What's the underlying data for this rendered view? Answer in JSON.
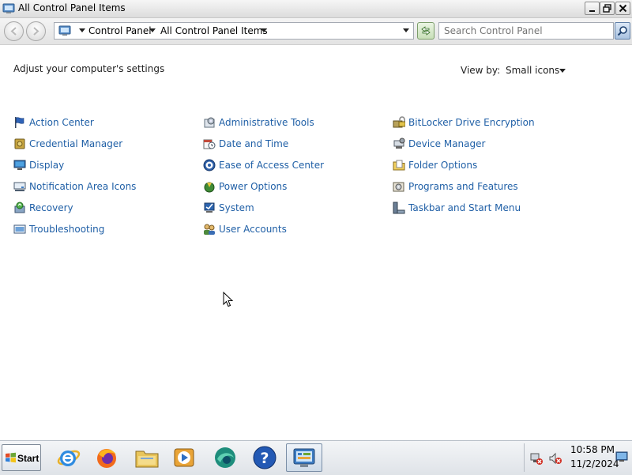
{
  "window": {
    "title": "All Control Panel Items"
  },
  "address_bar": {
    "breadcrumb": [
      "Control Panel",
      "All Control Panel Items"
    ],
    "search_placeholder": "Search Control Panel"
  },
  "content": {
    "heading": "Adjust your computer's settings",
    "view_by_label": "View by:",
    "view_by_value": "Small icons",
    "items": [
      {
        "label": "Action Center",
        "icon": "flag-icon"
      },
      {
        "label": "Credential Manager",
        "icon": "vault-icon"
      },
      {
        "label": "Display",
        "icon": "monitor-icon"
      },
      {
        "label": "Notification Area Icons",
        "icon": "notification-area-icon"
      },
      {
        "label": "Recovery",
        "icon": "recovery-icon"
      },
      {
        "label": "Troubleshooting",
        "icon": "troubleshooting-icon"
      },
      {
        "label": "Administrative Tools",
        "icon": "admin-tools-icon"
      },
      {
        "label": "Date and Time",
        "icon": "calendar-clock-icon"
      },
      {
        "label": "Ease of Access Center",
        "icon": "ease-of-access-icon"
      },
      {
        "label": "Power Options",
        "icon": "power-options-icon"
      },
      {
        "label": "System",
        "icon": "system-icon"
      },
      {
        "label": "User Accounts",
        "icon": "user-accounts-icon"
      },
      {
        "label": "BitLocker Drive Encryption",
        "icon": "bitlocker-icon"
      },
      {
        "label": "Device Manager",
        "icon": "device-manager-icon"
      },
      {
        "label": "Folder Options",
        "icon": "folder-options-icon"
      },
      {
        "label": "Programs and Features",
        "icon": "programs-features-icon"
      },
      {
        "label": "Taskbar and Start Menu",
        "icon": "taskbar-icon"
      }
    ]
  },
  "taskbar": {
    "start_label": "Start",
    "pinned": [
      "internet-explorer-icon",
      "firefox-icon",
      "file-explorer-icon",
      "media-player-icon",
      "browser-globe-icon",
      "help-icon",
      "control-panel-icon"
    ],
    "clock_time": "10:58 PM",
    "clock_date": "11/2/2024"
  },
  "colors": {
    "link": "#1f5fa6",
    "text": "#1e1e1e",
    "background": "#ffffff"
  }
}
